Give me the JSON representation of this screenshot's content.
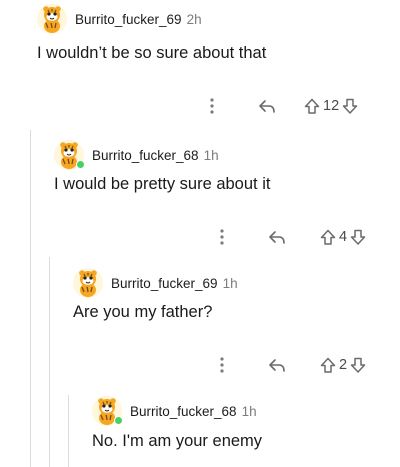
{
  "comments": [
    {
      "username": "Burrito_fucker_69",
      "time": "2h",
      "text": "I wouldn’t be so sure about that",
      "votes": "12",
      "online": false
    },
    {
      "username": "Burrito_fucker_68",
      "time": "1h",
      "text": "I would be pretty sure about it",
      "votes": "4",
      "online": true
    },
    {
      "username": "Burrito_fucker_69",
      "time": "1h",
      "text": "Are you my father?",
      "votes": "2",
      "online": false
    },
    {
      "username": "Burrito_fucker_68",
      "time": "1h",
      "text": "No. I'm am your enemy",
      "votes": "",
      "online": true
    }
  ],
  "icons": {
    "more": "more-options-icon",
    "reply": "reply-icon",
    "upvote": "upvote-arrow-icon",
    "downvote": "downvote-arrow-icon",
    "avatar": "tiger-snoo-avatar-icon"
  },
  "colors": {
    "online": "#46d160",
    "thread_line": "#dcdcdc",
    "avatar_orange": "#f5a623"
  }
}
